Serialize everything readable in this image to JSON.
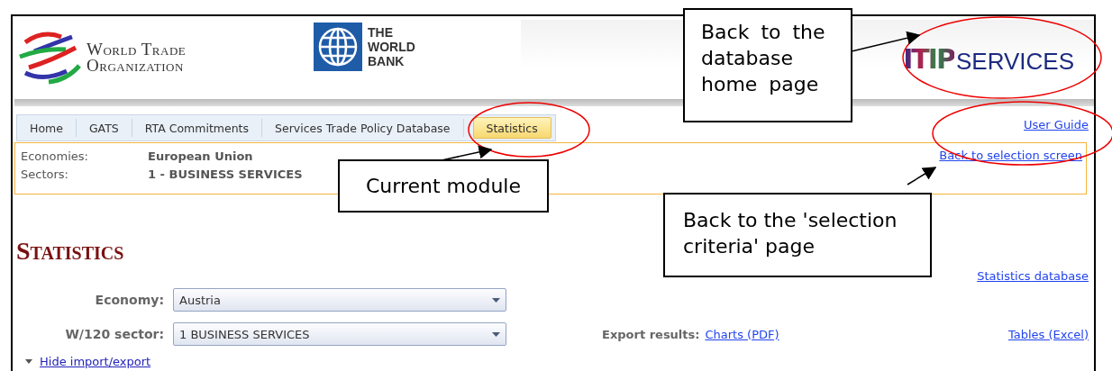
{
  "header": {
    "wto_logo": {
      "lines": [
        "World Trade",
        "Organization"
      ]
    },
    "world_bank_logo": {
      "lines": [
        "THE",
        "WORLD",
        "BANK"
      ]
    },
    "itip_logo": {
      "mark": "ITIP",
      "text": "SERVICES"
    }
  },
  "nav": {
    "tabs": [
      {
        "label": "Home",
        "selected": false
      },
      {
        "label": "GATS",
        "selected": false
      },
      {
        "label": "RTA Commitments",
        "selected": false
      },
      {
        "label": "Services Trade Policy Database",
        "selected": false
      },
      {
        "label": "Statistics",
        "selected": true
      }
    ],
    "user_guide": "User Guide"
  },
  "selection": {
    "rows": [
      {
        "label": "Economies:",
        "value": "European Union"
      },
      {
        "label": "Sectors:",
        "value": "1 - BUSINESS SERVICES"
      }
    ],
    "back_link": "Back to selection screen"
  },
  "page": {
    "title": "Statistics",
    "stats_link": "Statistics database",
    "fields": [
      {
        "label": "Economy:",
        "value": "Austria"
      },
      {
        "label": "W/120 sector:",
        "value": "1 BUSINESS SERVICES"
      }
    ],
    "export_label": "Export results:",
    "charts_link": "Charts (PDF)",
    "tables_link": "Tables (Excel)",
    "toggle": "Hide import/export"
  },
  "callouts": [
    {
      "text": "Back to the database home page"
    },
    {
      "text": "Current module"
    },
    {
      "text": "Back to the 'selection criteria' page"
    }
  ]
}
